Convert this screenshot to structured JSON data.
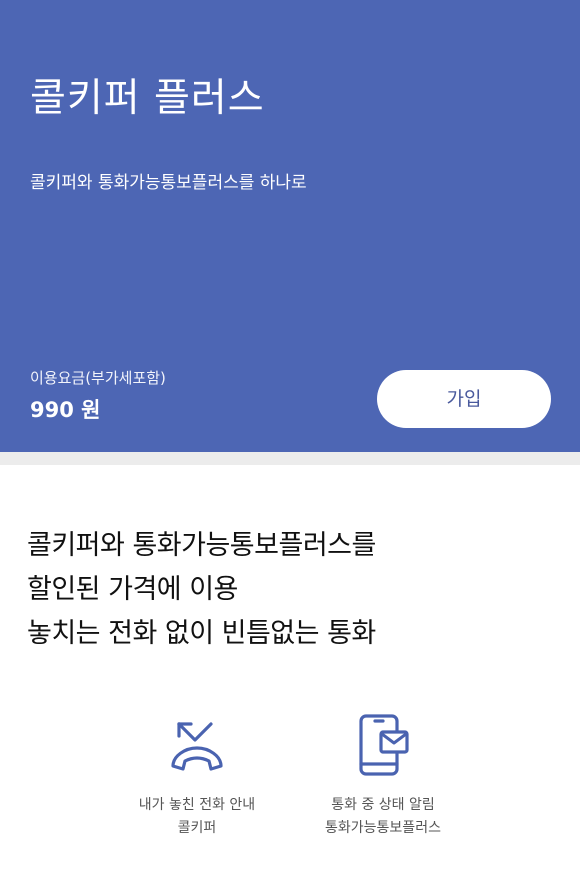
{
  "hero": {
    "title": "콜키퍼 플러스",
    "subtitle": "콜키퍼와 통화가능통보플러스를 하나로",
    "fee_label": "이용요금(부가세포함)",
    "fee_value": "990 원",
    "join_label": "가입",
    "background_color": "#4d66b4"
  },
  "description": {
    "lines": [
      "콜키퍼와 통화가능통보플러스를",
      "할인된 가격에 이용",
      "놓치는 전화 없이 빈틈없는 통화"
    ]
  },
  "features": [
    {
      "icon": "missed-call-icon",
      "line1": "내가 놓친 전화 안내",
      "line2": "콜키퍼"
    },
    {
      "icon": "phone-message-icon",
      "line1": "통화 중 상태 알림",
      "line2": "통화가능통보플러스"
    }
  ],
  "colors": {
    "accent": "#4d66b4",
    "icon_stroke": "#4a63b0"
  }
}
